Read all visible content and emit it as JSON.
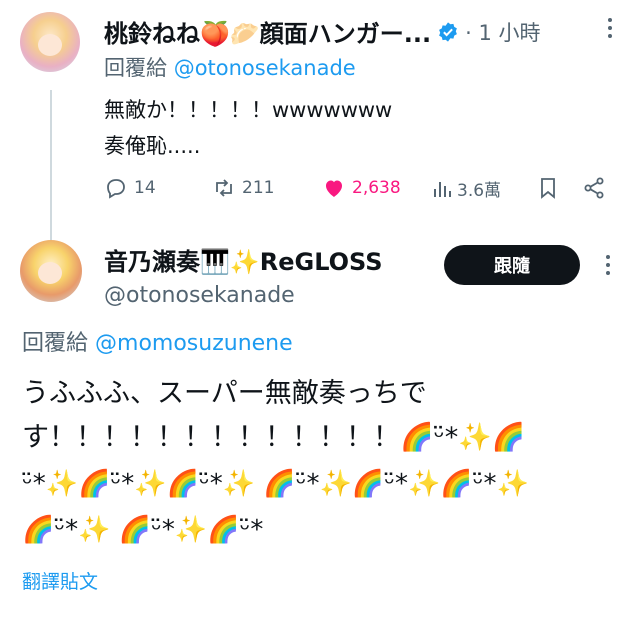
{
  "reply_tweet": {
    "display_name": "桃鈴ねね🍑🥟顔面ハンガー...",
    "time": "· 1 小時",
    "reply_prefix": "回覆給",
    "reply_to": "@otonosekanade",
    "text_line1": "無敵か！！！！！wwwwwww",
    "text_line2": "奏俺恥.....",
    "stats": {
      "replies": "14",
      "retweets": "211",
      "likes": "2,638",
      "views": "3.6萬"
    }
  },
  "main_tweet": {
    "display_name": "音乃瀬奏🎹✨ReGLOSS",
    "handle": "@otonosekanade",
    "follow_label": "跟隨",
    "reply_prefix": "回覆給",
    "reply_to": "@momosuzunene",
    "text_line1": "うふふふ、スーパー無敵奏っちで",
    "text_line2": "す！！！！！！！！！！！！！🌈ᵕ̈*✨🌈",
    "text_line3": "ᵕ̈*✨🌈ᵕ̈*✨🌈ᵕ̈*✨ 🌈ᵕ̈*✨🌈ᵕ̈*✨🌈ᵕ̈*✨",
    "text_line4": "🌈ᵕ̈*✨ 🌈ᵕ̈*✨🌈ᵕ̈*",
    "translate_label": "翻譯貼文"
  },
  "colors": {
    "accent": "#1d9bf0",
    "like": "#f91880",
    "text": "#0f1419",
    "muted": "#536471"
  },
  "icons": [
    "verified-badge-icon",
    "reply-icon",
    "retweet-icon",
    "like-icon",
    "views-icon",
    "bookmark-icon",
    "share-icon",
    "more-icon"
  ]
}
